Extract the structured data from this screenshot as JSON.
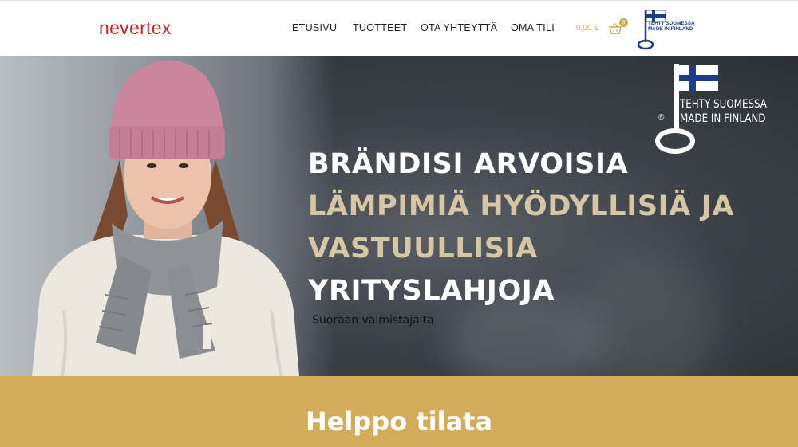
{
  "header": {
    "logo_text": "nevertex",
    "nav": [
      {
        "label": "ETUSIVU"
      },
      {
        "label": "TUOTTEET"
      },
      {
        "label": "OTA YHTEYTTÄ"
      },
      {
        "label": "OMA TILI"
      }
    ],
    "cart": {
      "price": "0,00 €",
      "count": "0"
    },
    "badge": {
      "line1": "TEHTY SUOMESSA",
      "line2": "MADE IN FINLAND"
    }
  },
  "hero": {
    "headline": [
      "BRÄNDISI ARVOISIA",
      "LÄMPIMIÄ HYÖDYLLISIÄ JA",
      "VASTUULLISIA",
      "YRITYSLAHJOJA"
    ],
    "subheadline": "Suoraan valmistajalta",
    "badge": {
      "line1": "TEHTY SUOMESSA",
      "line2": "MADE IN FINLAND",
      "reg": "®"
    }
  },
  "section": {
    "title": "Helppo tilata"
  },
  "colors": {
    "accent_gold": "#d2ac5a",
    "cream_text": "#d7c6a6",
    "brand_red": "#c0272d",
    "flag_blue": "#1a3f8a"
  }
}
